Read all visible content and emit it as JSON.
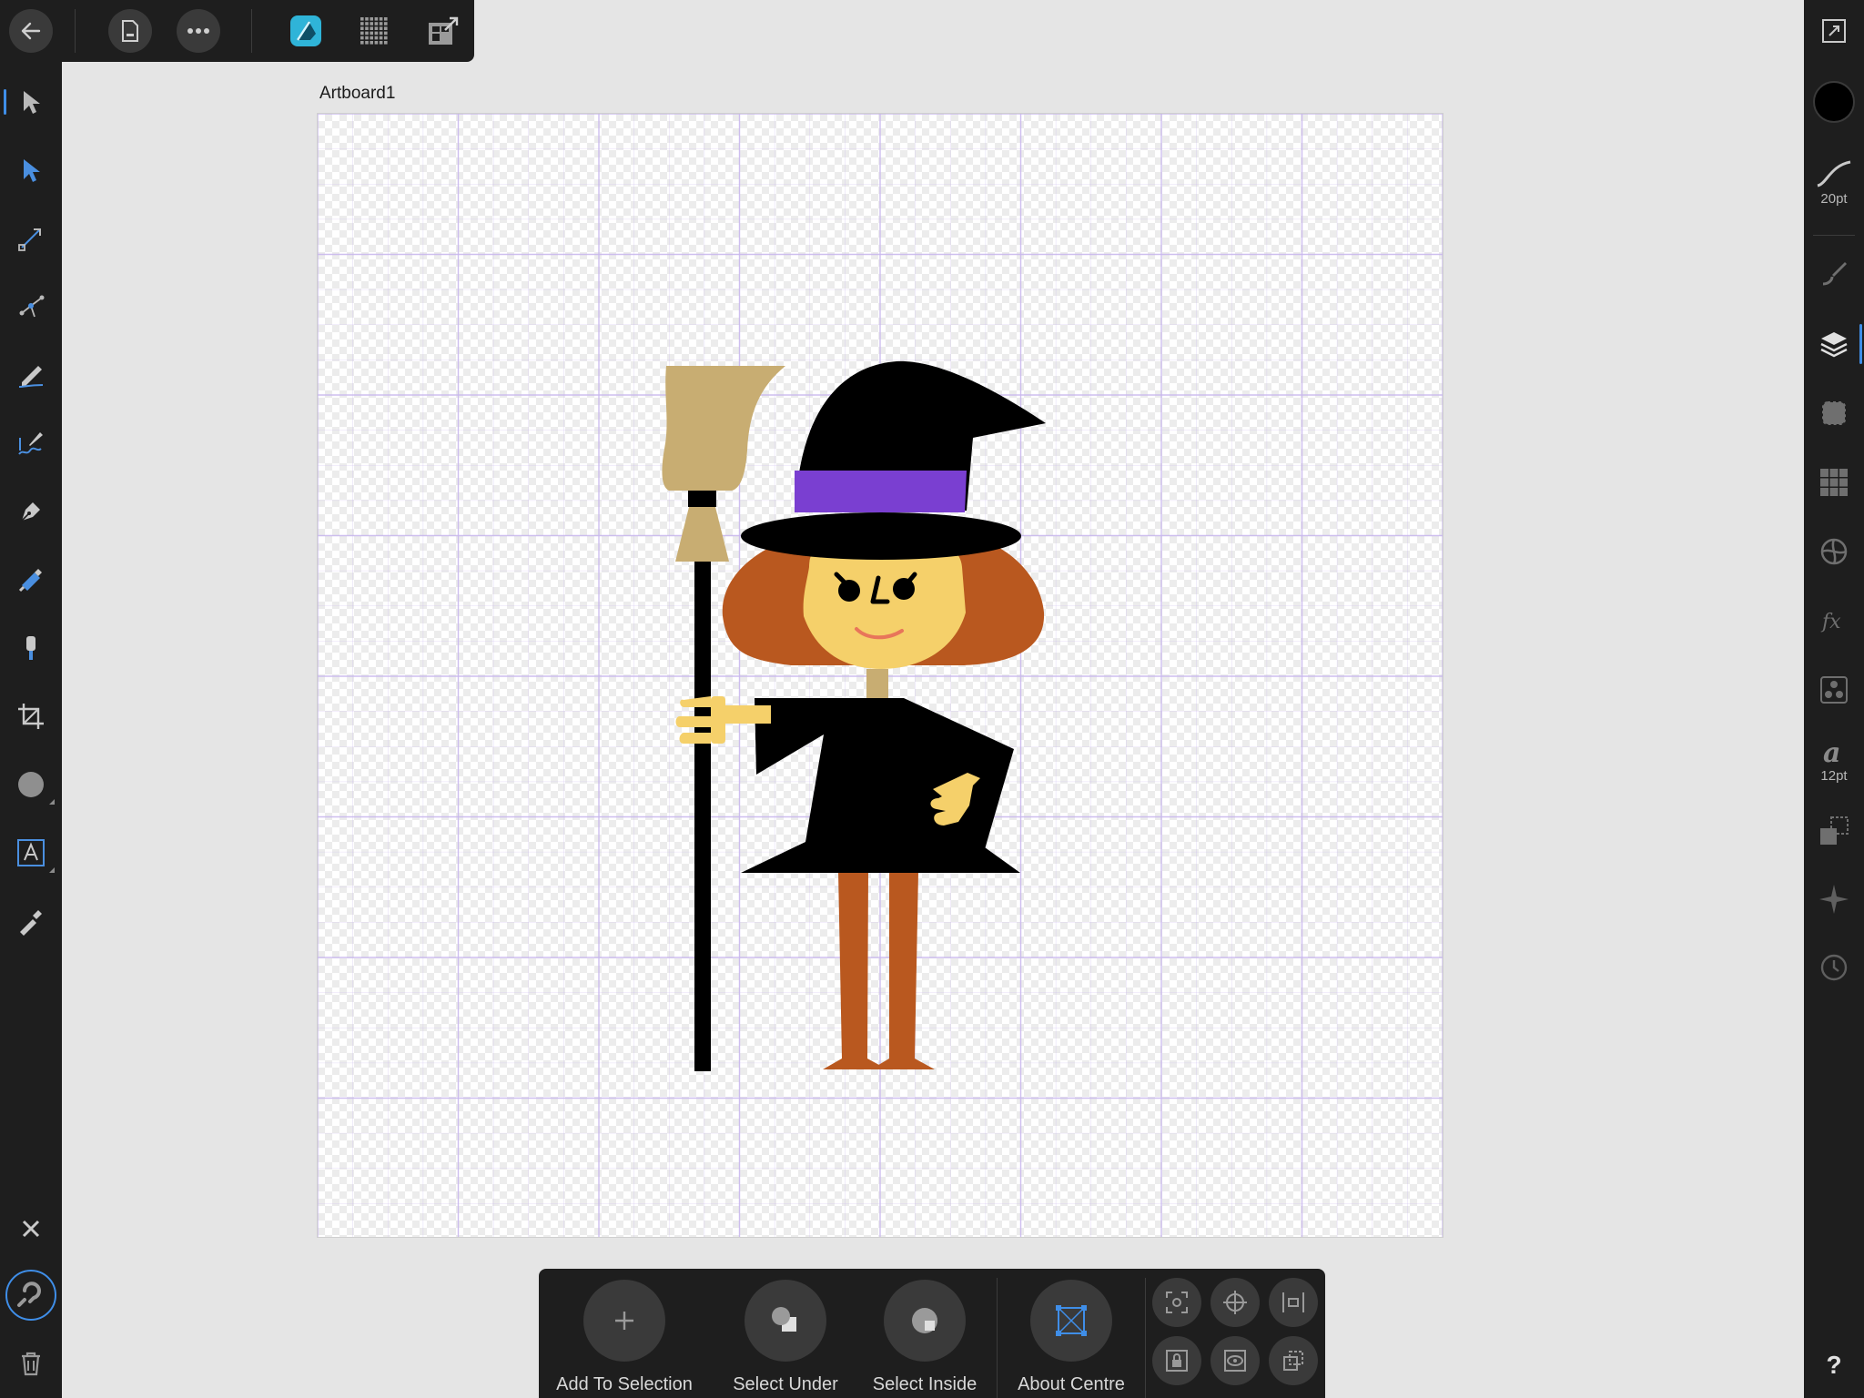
{
  "artboard": {
    "name": "Artboard1"
  },
  "top_toolbar": {
    "items": [
      {
        "icon": "back-arrow-icon"
      },
      {
        "icon": "document-icon"
      },
      {
        "icon": "more-dots-icon"
      },
      {
        "icon": "designer-persona-icon"
      },
      {
        "icon": "pixel-grid-icon"
      },
      {
        "icon": "export-persona-icon"
      }
    ]
  },
  "left_tools": [
    {
      "name": "move-tool",
      "active": true
    },
    {
      "name": "node-tool"
    },
    {
      "name": "corner-tool"
    },
    {
      "name": "point-transform-tool"
    },
    {
      "name": "pencil-tool"
    },
    {
      "name": "vector-brush-tool"
    },
    {
      "name": "pen-tool"
    },
    {
      "name": "fill-tool"
    },
    {
      "name": "transparency-tool"
    },
    {
      "name": "vector-crop-tool"
    },
    {
      "name": "ellipse-tool"
    },
    {
      "name": "artistic-text-tool"
    },
    {
      "name": "color-picker-tool"
    }
  ],
  "left_bottom": [
    {
      "name": "close"
    },
    {
      "name": "snapping",
      "active": true
    },
    {
      "name": "delete"
    }
  ],
  "right_studio": {
    "stroke_width": "20pt",
    "text_size": "12pt",
    "help_label": "?",
    "stroke_color": "#000000",
    "active_panel": "layers"
  },
  "context_toolbar": {
    "buttons": [
      {
        "label": "Add To Selection",
        "icon": "plus-icon"
      },
      {
        "label": "Select Under",
        "icon": "select-under-icon"
      },
      {
        "label": "Select Inside",
        "icon": "select-inside-icon"
      },
      {
        "label": "About Centre",
        "icon": "about-centre-icon",
        "active": true
      }
    ],
    "small_buttons": [
      "transform-origin-icon",
      "crosshair-icon",
      "align-icon",
      "lock-children-icon",
      "preview-icon",
      "transform-objects-icon"
    ]
  },
  "colors": {
    "panel": "#1e1e1e",
    "canvas": "#e5e5e5",
    "accent": "#3f8ee8",
    "grid": "#c9b8ee",
    "hat": "#000000",
    "hat_band": "#7a3fd1",
    "hair": "#b9581f",
    "skin": "#f5d06a",
    "broom": "#c8ad72"
  }
}
